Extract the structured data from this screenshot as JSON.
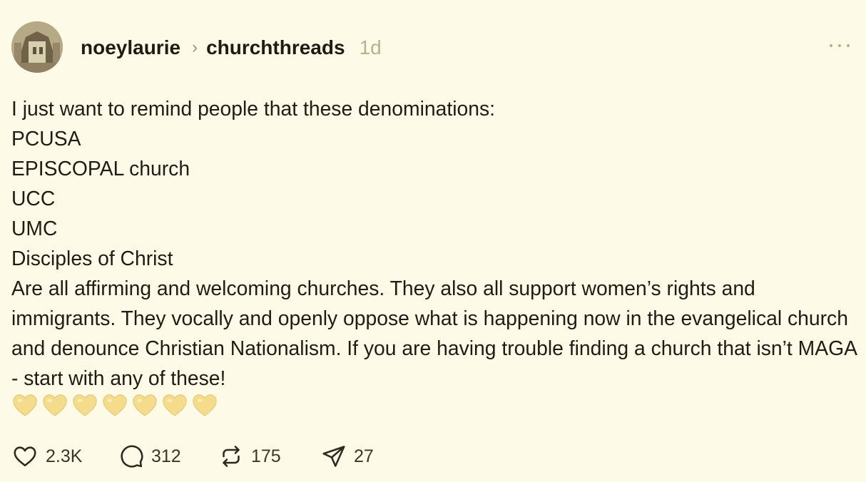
{
  "post": {
    "username": "noeylaurie",
    "community": "churchthreads",
    "time": "1d",
    "lines": [
      "I just want to remind people that these denominations:",
      "PCUSA",
      "EPISCOPAL church",
      "UCC",
      "UMC",
      "Disciples of Christ"
    ],
    "paragraph": "Are all affirming and welcoming churches. They also all support women’s rights and immigrants. They vocally and openly oppose what is happening now in the evangelical church and denounce Christian Nationalism. If you are having trouble finding a church that isn’t MAGA - start with any of these!",
    "heart_emoji_count": 7,
    "heart_emoji_color": "#f5dc8c"
  },
  "actions": {
    "likes": "2.3K",
    "replies": "312",
    "reposts": "175",
    "shares": "27"
  },
  "icons": [
    "avatar",
    "chevron-right-icon",
    "more-options-icon",
    "yellow-heart-icon",
    "heart-icon",
    "comment-icon",
    "repost-icon",
    "send-icon"
  ]
}
